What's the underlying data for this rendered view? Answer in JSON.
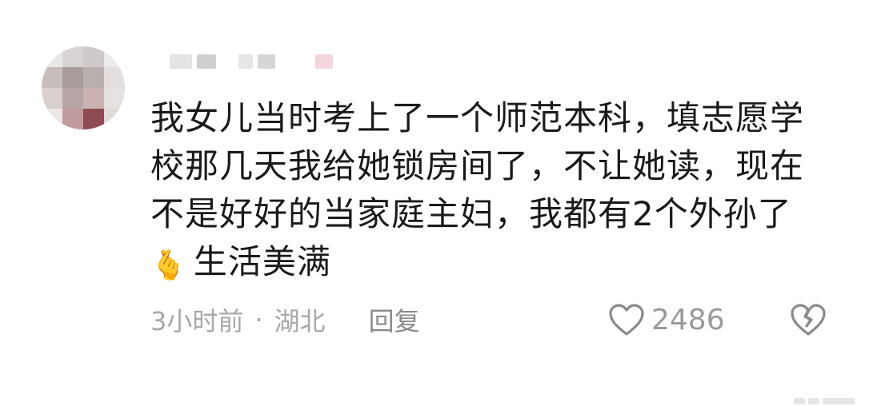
{
  "comment": {
    "text_line_1": "我女儿当时考上了一个师范本科，填志愿学",
    "text_line_2": "校那几天我给她锁房间了，不让她读，现在",
    "text_line_3": "不是好好的当家庭主妇，我都有2个外孙了",
    "text_line_4": "生活美满",
    "emoji": "🫰"
  },
  "meta": {
    "time": "3小时前",
    "separator": "·",
    "location": "湖北",
    "reply_label": "回复"
  },
  "likes": {
    "count": "2486"
  },
  "icons": {
    "like": "heart-outline-icon",
    "dislike": "broken-heart-icon"
  },
  "colors": {
    "text": "#1a1a1a",
    "meta": "#a8a8a8",
    "icon": "#8a8a8a"
  }
}
